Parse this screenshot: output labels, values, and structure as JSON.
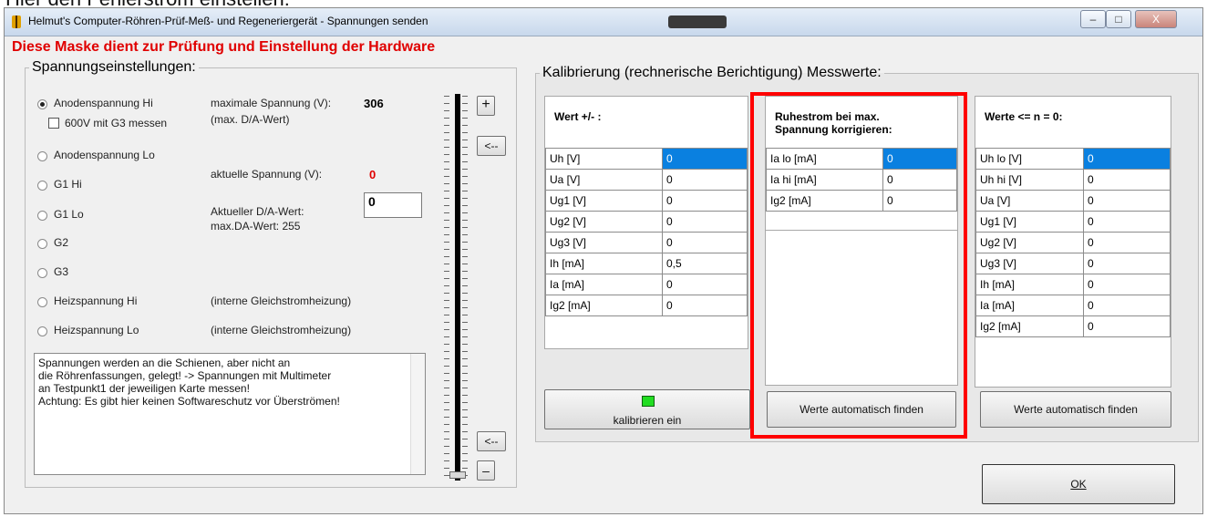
{
  "top_caption": "Hier den Fehlerstrom einstellen:",
  "window": {
    "title": "Helmut's Computer-Röhren-Prüf-Meß- und Regeneriergerät - Spannungen senden",
    "buttons": {
      "minimize": "–",
      "maximize": "□",
      "close": "X"
    }
  },
  "subtitle": "Diese Maske dient zur Prüfung und Einstellung der Hardware",
  "voltage_group": {
    "legend": "Spannungseinstellungen:",
    "radios": [
      "Anodenspannung Hi",
      "Anodenspannung Lo",
      "G1 Hi",
      "G1 Lo",
      "G2",
      "G3",
      "Heizspannung Hi",
      "Heizspannung Lo"
    ],
    "selected": "Anodenspannung Hi",
    "checkbox_label": "600V mit G3 messen",
    "max_voltage_label": "maximale Spannung (V):",
    "max_voltage_value": "306",
    "max_da_label": "(max. D/A-Wert)",
    "current_voltage_label": "aktuelle Spannung (V):",
    "current_voltage_value": "0",
    "current_da_label": "Aktueller D/A-Wert:",
    "current_da_value": "0",
    "max_da_wert": "max.DA-Wert: 255",
    "heiz_hi_note": "(interne Gleichstromheizung)",
    "heiz_lo_note": "(interne Gleichstromheizung)",
    "memo_lines": [
      "Spannungen werden an die Schienen, aber nicht an",
      "die Röhrenfassungen, gelegt! -> Spannungen mit Multimeter",
      "an Testpunkt1 der jeweiligen Karte messen!",
      "Achtung: Es gibt hier keinen Softwareschutz vor Überströmen!"
    ],
    "btn_plus": "+",
    "btn_arrow_top": "<--",
    "btn_arrow_bottom": "<--",
    "btn_minus": "–",
    "slider_level": 0
  },
  "calibration_group": {
    "legend": "Kalibrierung (rechnerische Berichtigung) Messwerte:",
    "panel1": {
      "title": "Wert +/- :",
      "rows": [
        [
          "Uh   [V]",
          "0"
        ],
        [
          "Ua   [V]",
          "0"
        ],
        [
          "Ug1  [V]",
          "0"
        ],
        [
          "Ug2  [V]",
          "0"
        ],
        [
          "Ug3  [V]",
          "0"
        ],
        [
          "Ih   [mA]",
          "0,5"
        ],
        [
          "Ia   [mA]",
          "0"
        ],
        [
          "Ig2  [mA]",
          "0"
        ]
      ],
      "button": "kalibrieren ein"
    },
    "panel2": {
      "title_line1": "Ruhestrom bei max.",
      "title_line2": "Spannung korrigieren:",
      "rows": [
        [
          "Ia lo [mA]",
          "0"
        ],
        [
          "Ia hi [mA]",
          "0"
        ],
        [
          "Ig2  [mA]",
          "0"
        ]
      ],
      "button": "Werte automatisch finden"
    },
    "panel3": {
      "title": "Werte <= n = 0:",
      "rows": [
        [
          "Uh lo  [V]",
          "0"
        ],
        [
          "Uh hi  [V]",
          "0"
        ],
        [
          "Ua     [V]",
          "0"
        ],
        [
          "Ug1   [V]",
          "0"
        ],
        [
          "Ug2   [V]",
          "0"
        ],
        [
          "Ug3   [V]",
          "0"
        ],
        [
          "Ih     [mA]",
          "0"
        ],
        [
          "Ia     [mA]",
          "0"
        ],
        [
          "Ig2   [mA]",
          "0"
        ]
      ],
      "button": "Werte automatisch finden"
    }
  },
  "ok_button": "OK",
  "colors": {
    "title_red": "#e00000",
    "selection_blue": "#0a80e0",
    "highlight_red": "#ff0000",
    "led_green": "#22dd22"
  }
}
